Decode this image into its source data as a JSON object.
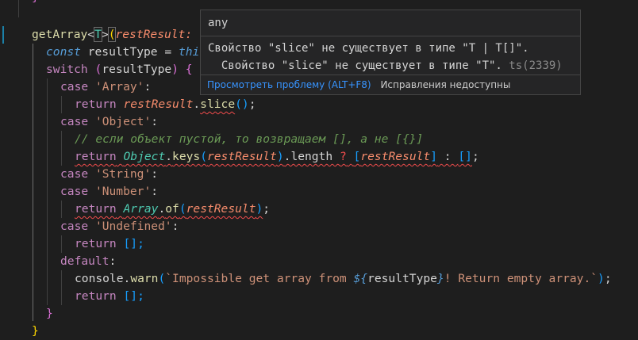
{
  "code": {
    "line0_brace": "}",
    "l1": {
      "fn": "getArray",
      "lt": "<",
      "T": "T",
      "gt": ">",
      "paren": "(",
      "param": "restResult:"
    },
    "l2": {
      "kw": "const",
      "var": " resultType ",
      "eq": "=",
      "rest": " thi"
    },
    "l3": {
      "kw": "switch",
      "sp": " ",
      "po": "(",
      "var": "resultType",
      "pc": ")",
      "brace": " {"
    },
    "l4": {
      "kw": "case",
      "str": " 'Array'",
      "colon": ":"
    },
    "l5": {
      "kw": "return",
      "param": " restResult",
      "dot": ".",
      "fn": "slice",
      "paren": "()",
      "semi": ";"
    },
    "l6": {
      "kw": "case",
      "str": " 'Object'",
      "colon": ":"
    },
    "l7": {
      "comment": "// если объект пустой, то возвращаем [], а не [{}]"
    },
    "l8": {
      "kw": "return",
      "obj": "Object",
      "dot": ".",
      "fn": "keys",
      "po": "(",
      "param": "restResult",
      "pc": ")",
      "len": ".length ",
      "q": "?",
      "sp": " ",
      "bo": "[",
      "param2": "restResult",
      "bc": "]",
      "colon": " : ",
      "arr": "[]",
      "semi": ";"
    },
    "l9": {
      "kw": "case",
      "str": " 'String'",
      "colon": ":"
    },
    "l10": {
      "kw": "case",
      "str": " 'Number'",
      "colon": ":"
    },
    "l11": {
      "kw": "return",
      "obj": "Array",
      "dot": ".",
      "fn": "of",
      "po": "(",
      "param": "restResult",
      "pc": ")",
      "semi": ";"
    },
    "l12": {
      "kw": "case",
      "str": " 'Undefined'",
      "colon": ":"
    },
    "l13": {
      "kw": "return",
      "rest": " [];"
    },
    "l14": {
      "kw": "default",
      "colon": ":"
    },
    "l15": {
      "obj": "console",
      "dot": ".",
      "fn": "warn",
      "po": "(",
      "str1": "`Impossible get array from ",
      "tpl_o": "${",
      "var": "resultType",
      "tpl_c": "}",
      "str2": "! Return empty array.`",
      "pc": ")",
      "semi": ";"
    },
    "l16": {
      "kw": "return",
      "rest": " [];"
    },
    "l17": {
      "brace": "}"
    },
    "l18": {
      "brace": "}"
    }
  },
  "hover": {
    "type": "any",
    "message_line1": "Свойство \"slice\" не существует в типе \"T | T[]\".",
    "message_line2": "  Свойство \"slice\" не существует в типе \"T\". ",
    "code": "ts(2339)",
    "view_problem": "Просмотреть проблему (ALT+F8)",
    "no_fixes": "Исправления недоступны"
  }
}
